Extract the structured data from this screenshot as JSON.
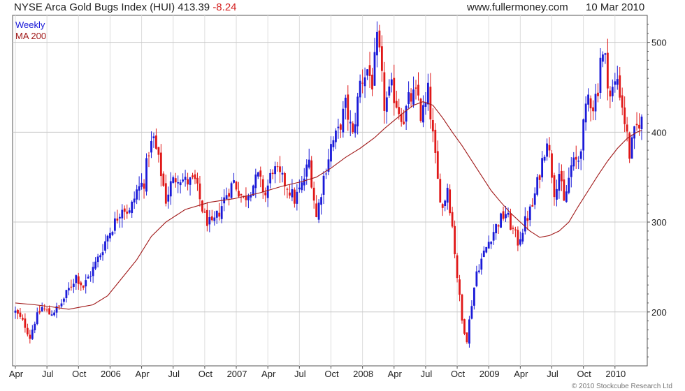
{
  "header": {
    "title": "NYSE Arca Gold Bugs Index (HUI) 413.39",
    "change": "-8.24",
    "site": "www.fullermoney.com",
    "date": "10 Mar 2010"
  },
  "footer": {
    "copyright": "© 2010 Stockcube Research Ltd"
  },
  "colors": {
    "up": "#1a1ad8",
    "down": "#e01818",
    "ma": "#a01818",
    "grid": "#c8c8c8",
    "axis": "#555555"
  },
  "chart_data": {
    "type": "line",
    "legend": [
      {
        "label": "Weekly",
        "color": "#1a1ad8"
      },
      {
        "label": "MA 200",
        "color": "#a01818"
      }
    ],
    "legend_position": "top-left",
    "y_axis_position": "right",
    "ylim": [
      140,
      530
    ],
    "yticks": [
      200,
      300,
      400,
      500
    ],
    "grid": true,
    "x_ticks": [
      {
        "label": "Apr",
        "week": 0
      },
      {
        "label": "Jul",
        "week": 13
      },
      {
        "label": "Oct",
        "week": 26
      },
      {
        "label": "2006",
        "week": 39
      },
      {
        "label": "Apr",
        "week": 52
      },
      {
        "label": "Jul",
        "week": 65
      },
      {
        "label": "Oct",
        "week": 78
      },
      {
        "label": "2007",
        "week": 91
      },
      {
        "label": "Apr",
        "week": 104
      },
      {
        "label": "Jul",
        "week": 117
      },
      {
        "label": "Oct",
        "week": 130
      },
      {
        "label": "2008",
        "week": 143
      },
      {
        "label": "Apr",
        "week": 156
      },
      {
        "label": "Jul",
        "week": 169
      },
      {
        "label": "Oct",
        "week": 182
      },
      {
        "label": "2009",
        "week": 195
      },
      {
        "label": "Apr",
        "week": 208
      },
      {
        "label": "Jul",
        "week": 221
      },
      {
        "label": "Oct",
        "week": 234
      },
      {
        "label": "2010",
        "week": 247
      }
    ],
    "weekly_close_path": [
      [
        0,
        200
      ],
      [
        4,
        185
      ],
      [
        6,
        172
      ],
      [
        8,
        190
      ],
      [
        11,
        205
      ],
      [
        14,
        198
      ],
      [
        18,
        205
      ],
      [
        22,
        225
      ],
      [
        25,
        240
      ],
      [
        28,
        228
      ],
      [
        32,
        248
      ],
      [
        35,
        265
      ],
      [
        38,
        285
      ],
      [
        41,
        300
      ],
      [
        44,
        318
      ],
      [
        47,
        310
      ],
      [
        50,
        335
      ],
      [
        53,
        345
      ],
      [
        55,
        380
      ],
      [
        57,
        392
      ],
      [
        60,
        355
      ],
      [
        62,
        325
      ],
      [
        64,
        342
      ],
      [
        67,
        352
      ],
      [
        70,
        345
      ],
      [
        74,
        345
      ],
      [
        78,
        305
      ],
      [
        81,
        295
      ],
      [
        84,
        312
      ],
      [
        87,
        332
      ],
      [
        90,
        345
      ],
      [
        94,
        325
      ],
      [
        97,
        338
      ],
      [
        100,
        350
      ],
      [
        103,
        330
      ],
      [
        106,
        360
      ],
      [
        109,
        350
      ],
      [
        112,
        340
      ],
      [
        115,
        325
      ],
      [
        118,
        340
      ],
      [
        121,
        368
      ],
      [
        124,
        305
      ],
      [
        127,
        350
      ],
      [
        130,
        385
      ],
      [
        133,
        400
      ],
      [
        136,
        430
      ],
      [
        139,
        395
      ],
      [
        142,
        455
      ],
      [
        145,
        470
      ],
      [
        147,
        455
      ],
      [
        149,
        500
      ],
      [
        150,
        485
      ],
      [
        152,
        430
      ],
      [
        155,
        448
      ],
      [
        158,
        425
      ],
      [
        160,
        415
      ],
      [
        162,
        435
      ],
      [
        164,
        440
      ],
      [
        166,
        440
      ],
      [
        167,
        418
      ],
      [
        169,
        430
      ],
      [
        170,
        445
      ],
      [
        172,
        395
      ],
      [
        174,
        345
      ],
      [
        176,
        315
      ],
      [
        178,
        340
      ],
      [
        180,
        295
      ],
      [
        182,
        240
      ],
      [
        184,
        190
      ],
      [
        186,
        170
      ],
      [
        188,
        210
      ],
      [
        190,
        245
      ],
      [
        193,
        265
      ],
      [
        196,
        285
      ],
      [
        199,
        300
      ],
      [
        202,
        310
      ],
      [
        205,
        290
      ],
      [
        207,
        278
      ],
      [
        210,
        300
      ],
      [
        213,
        318
      ],
      [
        216,
        355
      ],
      [
        219,
        395
      ],
      [
        222,
        335
      ],
      [
        224,
        355
      ],
      [
        226,
        320
      ],
      [
        229,
        362
      ],
      [
        232,
        370
      ],
      [
        234,
        405
      ],
      [
        236,
        440
      ],
      [
        238,
        430
      ],
      [
        240,
        450
      ],
      [
        241,
        485
      ],
      [
        243,
        480
      ],
      [
        245,
        440
      ],
      [
        248,
        460
      ],
      [
        250,
        430
      ],
      [
        252,
        395
      ],
      [
        253,
        375
      ],
      [
        255,
        398
      ],
      [
        257,
        412
      ],
      [
        258,
        413
      ]
    ],
    "ma200_path": [
      [
        0,
        210
      ],
      [
        8,
        208
      ],
      [
        14,
        206
      ],
      [
        22,
        203
      ],
      [
        32,
        208
      ],
      [
        38,
        218
      ],
      [
        44,
        238
      ],
      [
        50,
        258
      ],
      [
        56,
        284
      ],
      [
        62,
        300
      ],
      [
        70,
        314
      ],
      [
        80,
        322
      ],
      [
        90,
        326
      ],
      [
        100,
        332
      ],
      [
        110,
        340
      ],
      [
        118,
        345
      ],
      [
        124,
        350
      ],
      [
        130,
        360
      ],
      [
        136,
        372
      ],
      [
        142,
        382
      ],
      [
        148,
        394
      ],
      [
        152,
        404
      ],
      [
        156,
        413
      ],
      [
        160,
        422
      ],
      [
        164,
        430
      ],
      [
        168,
        434
      ],
      [
        172,
        430
      ],
      [
        176,
        416
      ],
      [
        180,
        400
      ],
      [
        184,
        385
      ],
      [
        190,
        360
      ],
      [
        196,
        335
      ],
      [
        200,
        322
      ],
      [
        204,
        310
      ],
      [
        208,
        300
      ],
      [
        212,
        290
      ],
      [
        216,
        283
      ],
      [
        220,
        285
      ],
      [
        224,
        290
      ],
      [
        228,
        300
      ],
      [
        232,
        318
      ],
      [
        236,
        335
      ],
      [
        240,
        352
      ],
      [
        244,
        368
      ],
      [
        248,
        382
      ],
      [
        252,
        393
      ],
      [
        256,
        400
      ],
      [
        258,
        402
      ]
    ],
    "n_weeks": 259
  }
}
